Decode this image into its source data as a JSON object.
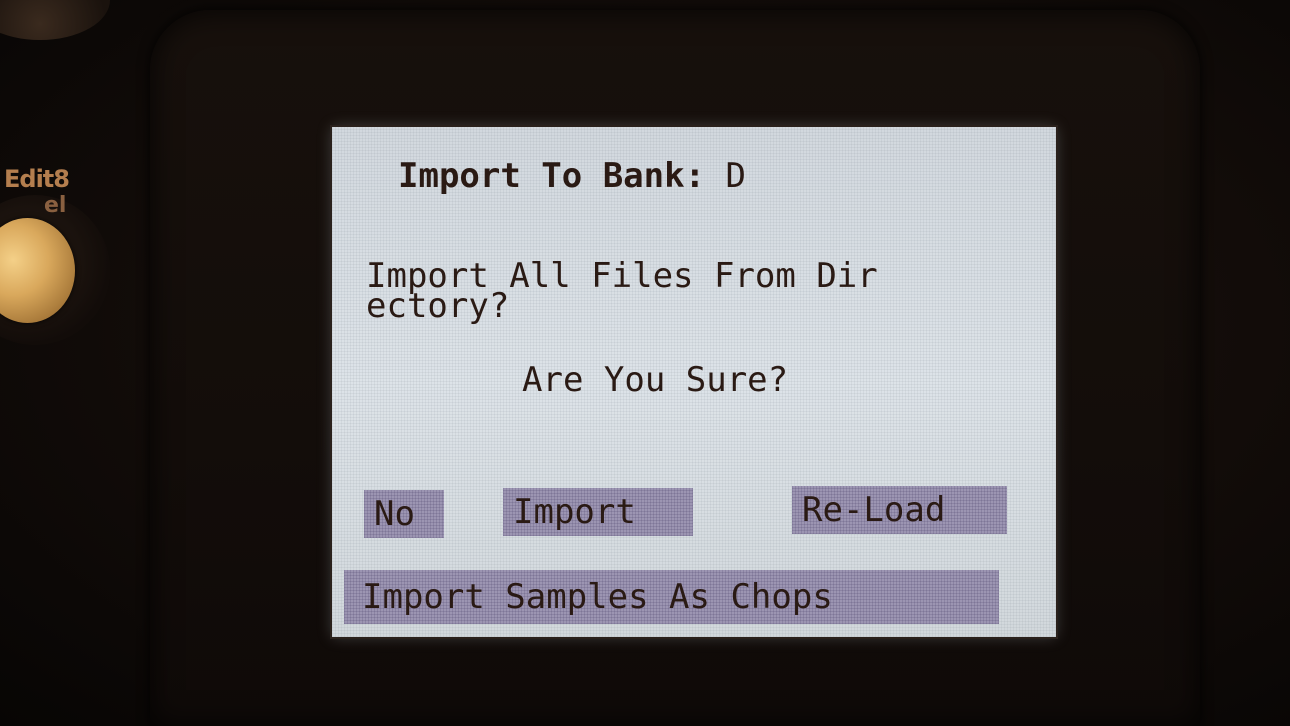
{
  "device": {
    "side_label_1": "Edit8",
    "side_label_2": "el"
  },
  "screen": {
    "title_label": "Import To Bank: ",
    "title_value": "D",
    "message_line_1": "Import All Files From Dir",
    "message_line_2": "ectory?",
    "confirm_prompt": "Are You Sure?",
    "buttons": {
      "no": "No",
      "import": "Import",
      "reload": "Re-Load",
      "import_as_chops": "Import Samples As Chops"
    }
  },
  "colors": {
    "lcd_background": "#d8dee3",
    "lcd_text": "#2a1a14",
    "button_fill": "#9c95b2",
    "knob_accent": "#d9a85c"
  }
}
